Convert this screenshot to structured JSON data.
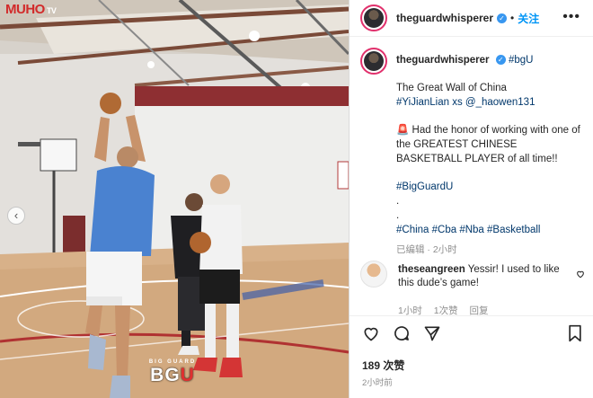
{
  "media": {
    "watermark": "MUHO",
    "watermark_suffix": "TV",
    "logo_arc": "BIG GUARD",
    "logo_main": "BG",
    "logo_accent": "U",
    "carousel_prev_icon": "chevron-left-icon"
  },
  "header": {
    "username": "theguardwhisperer",
    "verified_icon": "verified-badge-icon",
    "separator": "•",
    "follow_label": "关注",
    "more_icon": "more-horizontal-icon"
  },
  "caption": {
    "username": "theguardwhisperer",
    "first_tag": "#bgU",
    "line1": "The Great Wall of China",
    "tags_line": "#YiJianLian xs @_haowen131",
    "siren_icon": "🚨",
    "honor_text": "Had the honor of working with one of the GREATEST CHINESE BASKETBALL PLAYER of all time!!",
    "tag_bigguard": "#BigGuardU",
    "dot1": ".",
    "dot2": ".",
    "hashtags": "#China #Cba #Nba #Basketball",
    "edited": "已编辑 · 2小时"
  },
  "comment": {
    "username": "theseangreen",
    "text": "Yessir! I used to like this dude’s game!",
    "time": "1小时",
    "likes": "1次赞",
    "reply_label": "回复",
    "heart_icon": "heart-outline-icon"
  },
  "actions": {
    "like_icon": "heart-icon",
    "comment_icon": "comment-icon",
    "share_icon": "send-icon",
    "save_icon": "bookmark-icon"
  },
  "likes_count": "189 次赞",
  "timestamp": "2小时前",
  "colors": {
    "link": "#00376b",
    "follow": "#0095f6",
    "verified": "#3897f0",
    "muted": "#8e8e8e",
    "logo_accent": "#e03030"
  }
}
